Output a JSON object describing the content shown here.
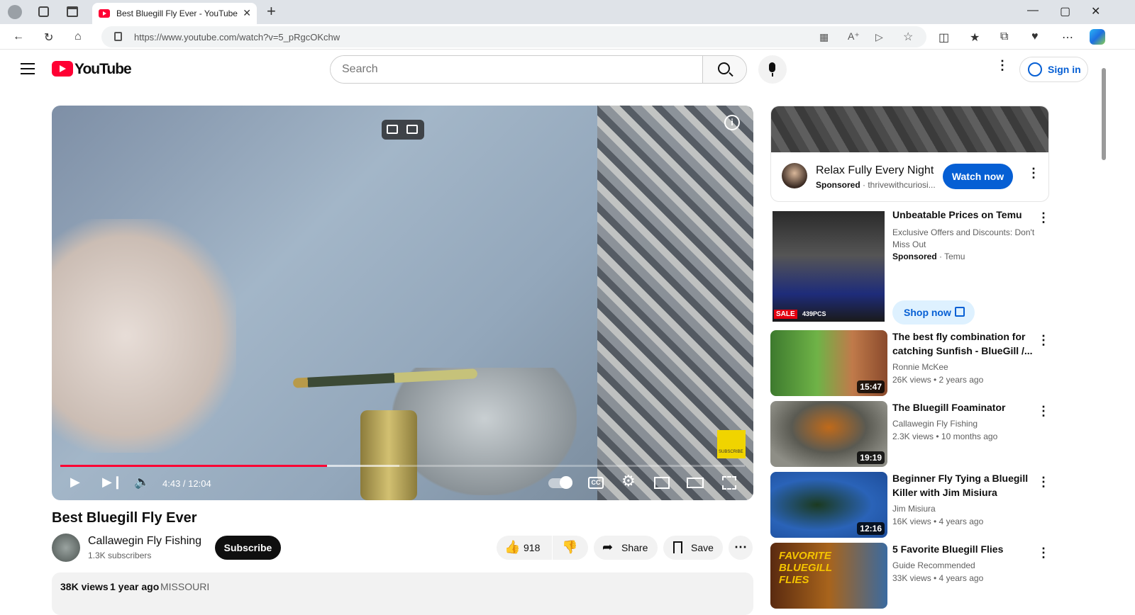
{
  "browser": {
    "tab_title": "Best Bluegill Fly Ever - YouTube",
    "url": "https://www.youtube.com/watch?v=5_pRgcOKchw",
    "new_tab": "+",
    "close_tab": "✕",
    "window_controls": {
      "minimize": "—",
      "maximize": "▢",
      "close": "✕"
    }
  },
  "header": {
    "logo_text": "YouTube",
    "search_placeholder": "Search",
    "signin_label": "Sign in"
  },
  "player": {
    "time": "4:43 / 12:04",
    "progress_played": 0.39,
    "subscribe_badge": "SUBSCRIBE"
  },
  "video": {
    "title": "Best Bluegill Fly Ever",
    "channel": "Callawegin Fly Fishing",
    "subscribers": "1.3K subscribers",
    "subscribe_label": "Subscribe",
    "likes": "918",
    "share_label": "Share",
    "save_label": "Save",
    "views": "38K views",
    "age": "1 year ago",
    "tag": "MISSOURI"
  },
  "sidebar": {
    "ad1": {
      "title": "Relax Fully Every Night",
      "sponsored": "Sponsored",
      "domain": "thrivewithcuriosi...",
      "cta": "Watch now"
    },
    "ad2": {
      "title": "Unbeatable Prices on Temu",
      "desc": "Exclusive Offers and Discounts: Don't Miss Out",
      "sponsored": "Sponsored",
      "advertiser": "Temu",
      "cta": "Shop now",
      "sale": "SALE",
      "pcs": "439PCS"
    },
    "videos": [
      {
        "title": "The best fly combination for catching Sunfish - BlueGill /...",
        "channel": "Ronnie McKee",
        "meta": "26K views • 2 years ago",
        "duration": "15:47"
      },
      {
        "title": "The Bluegill Foaminator",
        "channel": "Callawegin Fly Fishing",
        "meta": "2.3K views • 10 months ago",
        "duration": "19:19"
      },
      {
        "title": "Beginner Fly Tying a Bluegill Killer with Jim Misiura",
        "channel": "Jim Misiura",
        "meta": "16K views • 4 years ago",
        "duration": "12:16"
      },
      {
        "title": "5 Favorite Bluegill Flies",
        "channel": "Guide Recommended",
        "meta": "33K views • 4 years ago",
        "duration": ""
      }
    ],
    "thumb4_text": "FAVORITE BLUEGILL FLIES"
  },
  "icons": [
    "user-icon",
    "workspaces-icon",
    "tab-actions-icon",
    "back-icon",
    "refresh-icon",
    "home-icon",
    "lock-icon",
    "menu-icon",
    "search-icon",
    "mic-icon",
    "more-icon",
    "play-icon",
    "next-icon",
    "volume-icon",
    "autoplay-icon",
    "cc-icon",
    "settings-icon",
    "miniplayer-icon",
    "theater-icon",
    "fullscreen-icon",
    "like-icon",
    "dislike-icon",
    "share-icon",
    "save-icon"
  ],
  "colors": {
    "brand": "#ff0033",
    "accent": "#065fd4",
    "dark": "#0f0f0f"
  }
}
